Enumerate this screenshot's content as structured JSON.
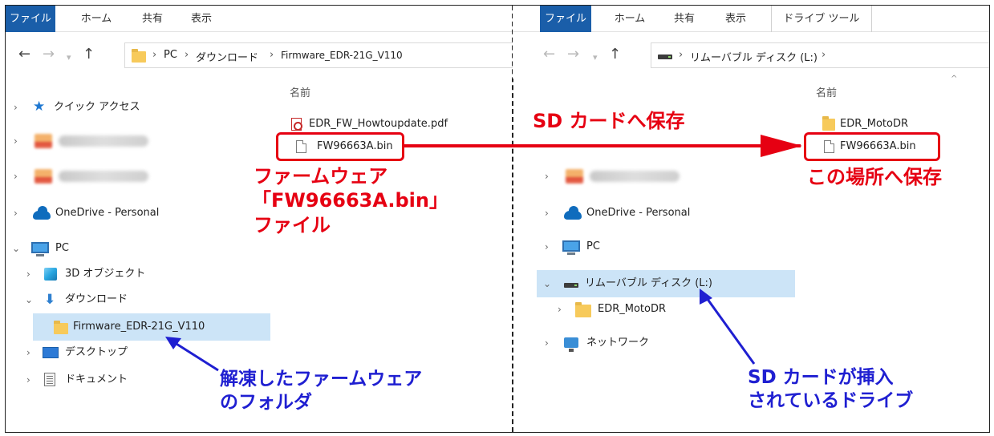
{
  "left": {
    "ribbon": {
      "tabs": [
        "ファイル",
        "ホーム",
        "共有",
        "表示"
      ]
    },
    "address": {
      "crumbs": [
        "PC",
        "ダウンロード",
        "Firmware_EDR-21G_V110"
      ]
    },
    "tree": {
      "quick_access": "クイック アクセス",
      "onedrive": "OneDrive - Personal",
      "pc": "PC",
      "objects3d": "3D オブジェクト",
      "downloads": "ダウンロード",
      "firmware_folder": "Firmware_EDR-21G_V110",
      "desktop": "デスクトップ",
      "documents": "ドキュメント"
    },
    "list": {
      "column_name": "名前",
      "files": [
        "EDR_FW_Howtoupdate.pdf",
        "FW96663A.bin"
      ]
    }
  },
  "right": {
    "ribbon": {
      "tabs": [
        "ファイル",
        "ホーム",
        "共有",
        "表示",
        "ドライブ ツール"
      ]
    },
    "address": {
      "crumbs": [
        "リムーバブル ディスク (L:)"
      ]
    },
    "tree": {
      "onedrive": "OneDrive - Personal",
      "pc": "PC",
      "removable": "リムーバブル ディスク (L:)",
      "motodr": "EDR_MotoDR",
      "network": "ネットワーク"
    },
    "list": {
      "column_name": "名前",
      "files": [
        "EDR_MotoDR",
        "FW96663A.bin"
      ]
    }
  },
  "annotations": {
    "save_to_sd": "SD カードへ保存",
    "firmware_file": [
      "ファームウェア",
      "「FW96663A.bin」",
      "ファイル"
    ],
    "save_here": "この場所へ保存",
    "extracted_folder": [
      "解凍したファームウェア",
      "のフォルダ"
    ],
    "sd_drive": [
      "SD カードが挿入",
      "されているドライブ"
    ]
  },
  "colors": {
    "annotation_red": "#e60012",
    "annotation_blue": "#1f1fd1",
    "file_tab": "#1a5ea9",
    "selection": "#cce4f7"
  }
}
